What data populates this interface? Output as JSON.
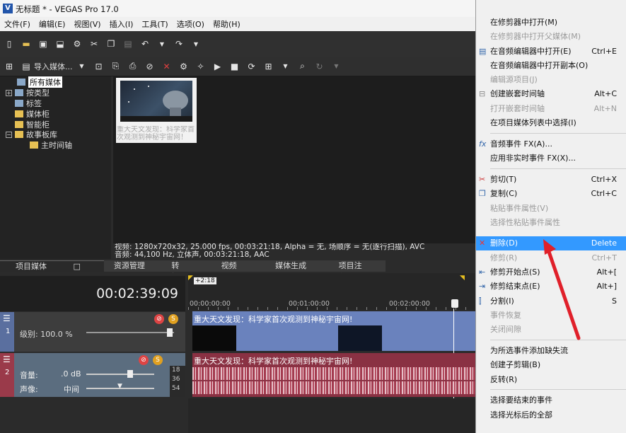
{
  "window": {
    "title": "无标题 * - VEGAS Pro 17.0"
  },
  "menu": [
    "文件(F)",
    "编辑(E)",
    "视图(V)",
    "插入(I)",
    "工具(T)",
    "选项(O)",
    "帮助(H)"
  ],
  "media_toolbar": {
    "import_label": "导入媒体..."
  },
  "tree": {
    "items": [
      "所有媒体",
      "按类型",
      "标签",
      "媒体柜",
      "智能柜",
      "故事板库",
      "主时间轴"
    ]
  },
  "media": {
    "thumb_caption": "重大天文发现：科学家首次观测到神秘宇宙网！"
  },
  "info": {
    "line1": "视频: 1280x720x32, 25.000 fps, 00:03:21:18, Alpha = 无, 场顺序 = 无(逐行扫描), AVC",
    "line2": "音频: 44,100 Hz, 立体声, 00:03:21:18, AAC"
  },
  "tabs": [
    "项目媒体",
    "资源管理器",
    "转场",
    "视频 FX",
    "媒体生成器",
    "项目注释"
  ],
  "timeline": {
    "timecode": "00:02:39:09",
    "marker": "+2:18",
    "ruler": [
      "00:00:00:00",
      "00:01:00:00",
      "00:02:00:00"
    ],
    "video_track": {
      "num": "1",
      "level_label": "级别: 100.0 %"
    },
    "audio_track": {
      "num": "2",
      "volume_label": "音量:",
      "volume_value": ".0 dB",
      "pan_label": "声像:",
      "pan_value": "中间",
      "meter": [
        "18",
        "36",
        "54"
      ]
    },
    "event_title": "重大天文发现：科学家首次观测到神秘宇宙网!"
  },
  "context_menu": {
    "items": [
      {
        "label": "在修剪器中打开(M)",
        "shortcut": "",
        "disabled": false
      },
      {
        "label": "在修剪器中打开父媒体(M)",
        "shortcut": "",
        "disabled": true
      },
      {
        "label": "在音频编辑器中打开(E)",
        "shortcut": "Ctrl+E",
        "disabled": false
      },
      {
        "label": "在音频编辑器中打开副本(O)",
        "shortcut": "",
        "disabled": false
      },
      {
        "label": "编辑源项目(J)",
        "shortcut": "",
        "disabled": true
      },
      {
        "label": "创建嵌套时间轴",
        "shortcut": "Alt+C",
        "disabled": false
      },
      {
        "label": "打开嵌套时间轴",
        "shortcut": "Alt+N",
        "disabled": true
      },
      {
        "label": "在项目媒体列表中选择(I)",
        "shortcut": "",
        "disabled": false
      },
      {
        "label": "音频事件 FX(A)...",
        "shortcut": "",
        "disabled": false
      },
      {
        "label": "应用非实时事件 FX(X)...",
        "shortcut": "",
        "disabled": false
      },
      {
        "label": "剪切(T)",
        "shortcut": "Ctrl+X",
        "disabled": false
      },
      {
        "label": "复制(C)",
        "shortcut": "Ctrl+C",
        "disabled": false
      },
      {
        "label": "粘贴事件属性(V)",
        "shortcut": "",
        "disabled": true
      },
      {
        "label": "选择性粘贴事件属性",
        "shortcut": "",
        "disabled": true
      },
      {
        "label": "删除(D)",
        "shortcut": "Delete",
        "disabled": false,
        "highlight": true
      },
      {
        "label": "修剪(R)",
        "shortcut": "Ctrl+T",
        "disabled": true
      },
      {
        "label": "修剪开始点(S)",
        "shortcut": "Alt+[",
        "disabled": false
      },
      {
        "label": "修剪结束点(E)",
        "shortcut": "Alt+]",
        "disabled": false
      },
      {
        "label": "分割(I)",
        "shortcut": "S",
        "disabled": false
      },
      {
        "label": "事件恢复",
        "shortcut": "",
        "disabled": true
      },
      {
        "label": "关闭间隙",
        "shortcut": "",
        "disabled": true
      },
      {
        "label": "为所选事件添加缺失流",
        "shortcut": "",
        "disabled": false
      },
      {
        "label": "创建子剪辑(B)",
        "shortcut": "",
        "disabled": false
      },
      {
        "label": "反转(R)",
        "shortcut": "",
        "disabled": false
      },
      {
        "label": "选择要结束的事件",
        "shortcut": "",
        "disabled": false
      },
      {
        "label": "选择光标后的全部",
        "shortcut": "",
        "disabled": false
      }
    ]
  },
  "colors": {
    "accent": "#3399ff",
    "arrow": "#e0202a",
    "video_event": "#6a82bd",
    "audio_event": "#8a3143"
  }
}
